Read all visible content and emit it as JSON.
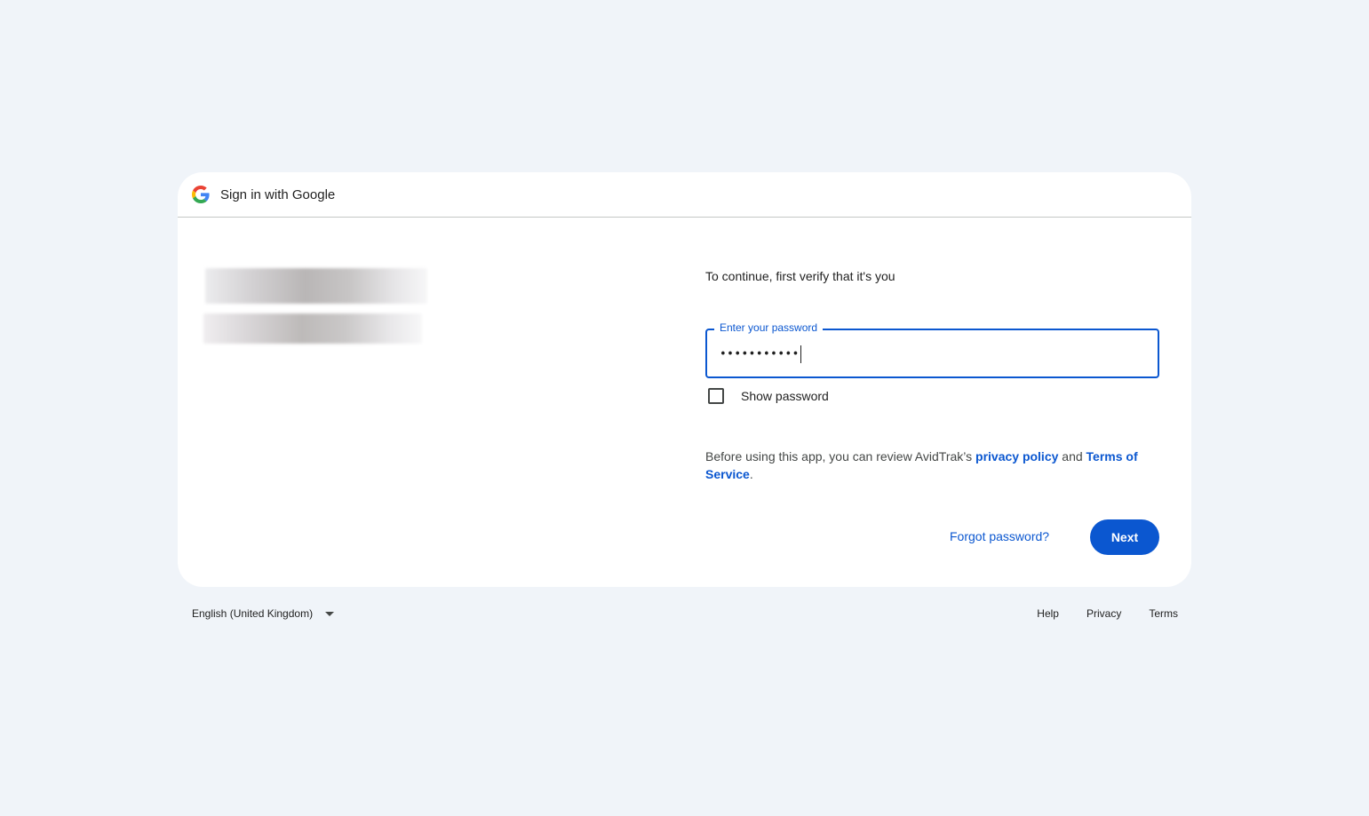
{
  "header": {
    "title": "Sign in with Google",
    "logo_icon": "google-g-icon"
  },
  "main": {
    "verify_text": "To continue, first verify that it's you",
    "password_field": {
      "label": "Enter your password",
      "value": "•••••••••••"
    },
    "show_password": {
      "label": "Show password",
      "checked": false
    },
    "policy": {
      "prefix": "Before using this app, you can review AvidTrak’s ",
      "privacy_link": "privacy policy",
      "middle": " and ",
      "terms_link": "Terms of Service",
      "suffix": "."
    },
    "forgot_password": "Forgot password?",
    "next_button": "Next"
  },
  "footer": {
    "language": "English (United Kingdom)",
    "links": [
      "Help",
      "Privacy",
      "Terms"
    ]
  },
  "colors": {
    "page_background": "#f0f4f9",
    "accent": "#0b57d0",
    "card_background": "#ffffff"
  }
}
